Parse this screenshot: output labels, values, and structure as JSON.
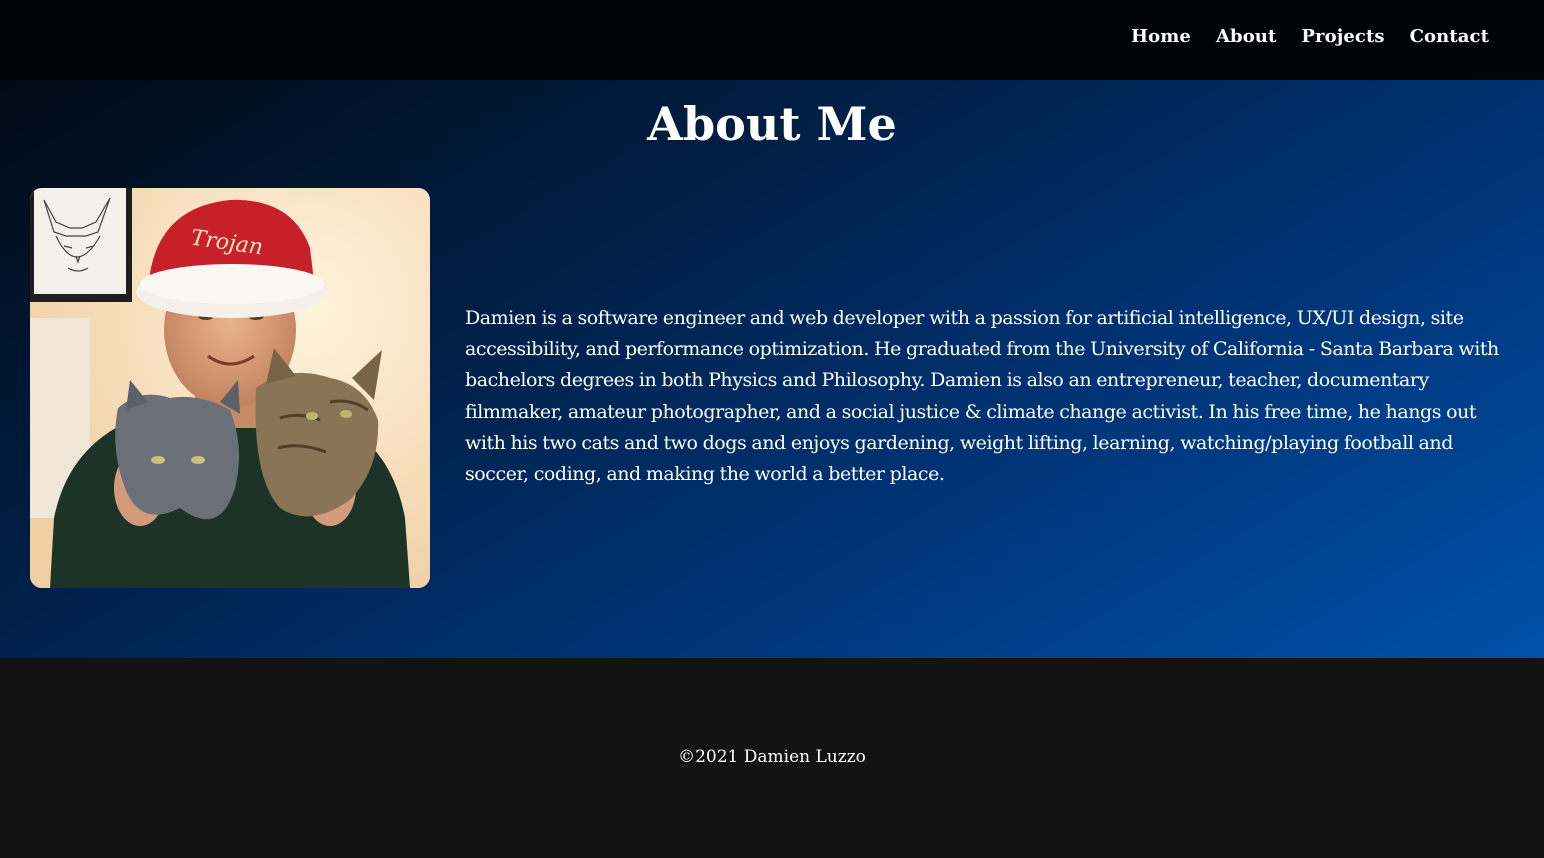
{
  "nav": {
    "items": [
      {
        "label": "Home"
      },
      {
        "label": "About"
      },
      {
        "label": "Projects"
      },
      {
        "label": "Contact"
      }
    ]
  },
  "about": {
    "title": "About Me",
    "bio": "Damien is a software engineer and web developer with a passion for artificial intelligence, UX/UI design, site accessibility, and performance optimization. He graduated from the University of California - Santa Barbara with bachelors degrees in both Physics and Philosophy. Damien is also an entrepreneur, teacher, documentary filmmaker, amateur photographer, and a social justice & climate change activist. In his free time, he hangs out with his two cats and two dogs and enjoys gardening, weight lifting, learning, watching/playing football and soccer, coding, and making the world a better place.",
    "photo_hat_text": "Trojan"
  },
  "footer": {
    "copyright": "©2021 Damien Luzzo"
  },
  "colors": {
    "navbar_bg": "#020305",
    "gradient_start": "#000a14",
    "gradient_end": "#0051a9",
    "footer_bg": "#131313",
    "text": "#ffffff"
  }
}
